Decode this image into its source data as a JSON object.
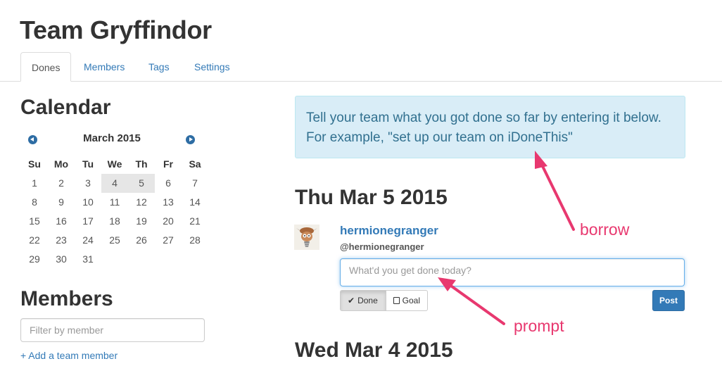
{
  "header": {
    "team_name": "Team Gryffindor"
  },
  "tabs": [
    {
      "label": "Dones",
      "active": true
    },
    {
      "label": "Members"
    },
    {
      "label": "Tags"
    },
    {
      "label": "Settings"
    }
  ],
  "calendar": {
    "heading": "Calendar",
    "month_label": "March 2015",
    "weekdays": [
      "Su",
      "Mo",
      "Tu",
      "We",
      "Th",
      "Fr",
      "Sa"
    ],
    "weeks": [
      [
        "1",
        "2",
        "3",
        "4",
        "5",
        "6",
        "7"
      ],
      [
        "8",
        "9",
        "10",
        "11",
        "12",
        "13",
        "14"
      ],
      [
        "15",
        "16",
        "17",
        "18",
        "19",
        "20",
        "21"
      ],
      [
        "22",
        "23",
        "24",
        "25",
        "26",
        "27",
        "28"
      ],
      [
        "29",
        "30",
        "31",
        "",
        "",
        "",
        ""
      ]
    ],
    "highlighted_days": [
      "4",
      "5"
    ]
  },
  "members_panel": {
    "heading": "Members",
    "filter_placeholder": "Filter by member",
    "add_link": "+ Add a team member"
  },
  "info_box": {
    "text": "Tell your team what you got done so far by entering it below. For example, \"set up our team on iDoneThis\""
  },
  "entry": {
    "date_heading": "Thu Mar 5 2015",
    "username": "hermionegranger",
    "handle": "@hermionegranger",
    "input_placeholder": "What'd you get done today?",
    "done_label": "Done",
    "goal_label": "Goal",
    "post_label": "Post"
  },
  "next_date_heading": "Wed Mar 4 2015",
  "annotations": {
    "borrow_label": "borrow",
    "prompt_label": "prompt",
    "color": "#e8386f"
  },
  "colors": {
    "link": "#337ab7",
    "info_bg": "#d9edf7",
    "info_text": "#31708f",
    "primary": "#337ab7"
  }
}
